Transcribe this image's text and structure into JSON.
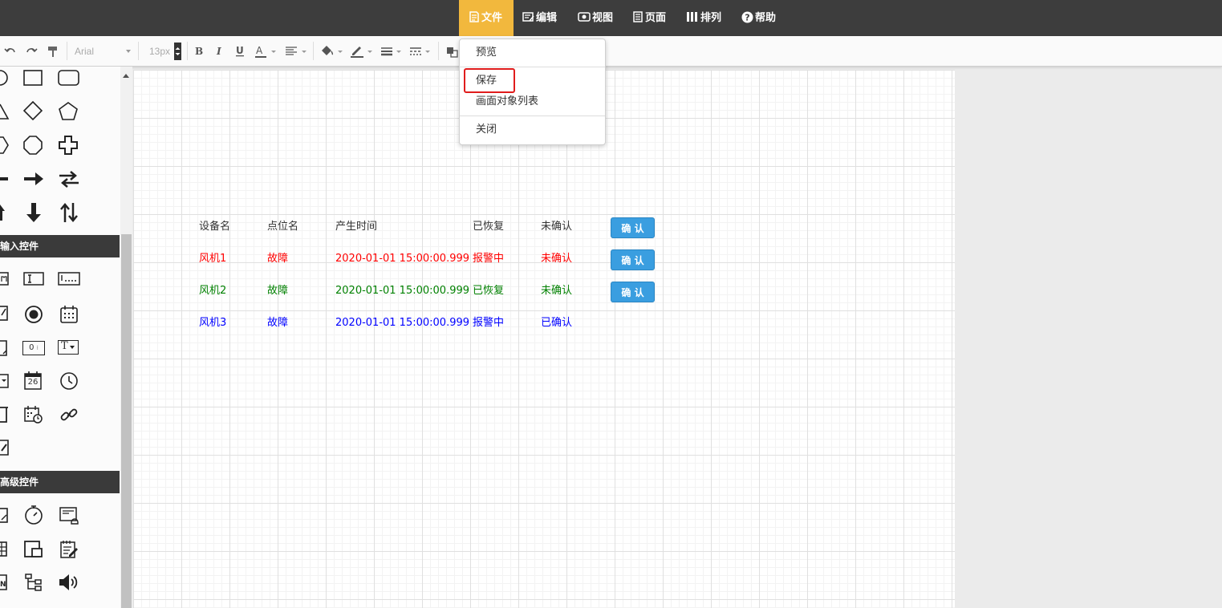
{
  "menubar": {
    "items": [
      {
        "label": "文件",
        "icon": "file-icon"
      },
      {
        "label": "编辑",
        "icon": "edit-icon"
      },
      {
        "label": "视图",
        "icon": "eye-icon"
      },
      {
        "label": "页面",
        "icon": "page-icon"
      },
      {
        "label": "排列",
        "icon": "arrange-icon"
      },
      {
        "label": "帮助",
        "icon": "help-icon"
      }
    ],
    "active_color": "#f2b83d"
  },
  "toolbar": {
    "font_family": "Arial",
    "font_size": "13px"
  },
  "sidebar": {
    "sections": [
      {
        "title": "输入控件"
      },
      {
        "title": "高级控件"
      }
    ],
    "number_widget_text": "0",
    "date_widget_text": "26",
    "text_widget_text": "T"
  },
  "file_menu": {
    "items": [
      "预览",
      "保存",
      "画面对象列表",
      "关闭"
    ]
  },
  "alarm_table": {
    "headers": [
      "设备名",
      "点位名",
      "产生时间",
      "已恢复",
      "未确认"
    ],
    "header_button": "确 认",
    "rows": [
      {
        "device": "风机1",
        "point": "故障",
        "time": "2020-01-01 15:00:00.999",
        "state": "报警中",
        "ack": "未确认",
        "button": "确 认",
        "color": "#ff0000"
      },
      {
        "device": "风机2",
        "point": "故障",
        "time": "2020-01-01 15:00:00.999",
        "state": "已恢复",
        "ack": "未确认",
        "button": "确 认",
        "color": "#008000"
      },
      {
        "device": "风机3",
        "point": "故障",
        "time": "2020-01-01 15:00:00.999",
        "state": "报警中",
        "ack": "已确认",
        "color": "#0000ff"
      }
    ]
  }
}
